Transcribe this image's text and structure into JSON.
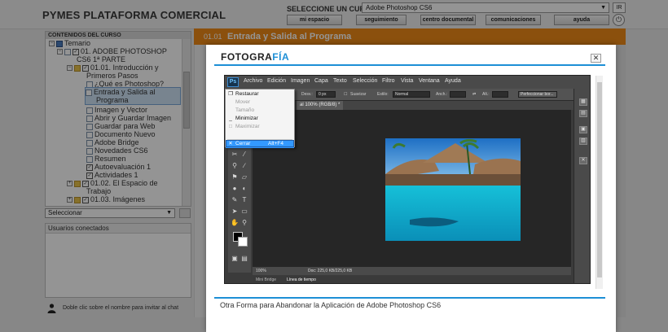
{
  "app": {
    "brand": "PYMES PLATAFORMA COMERCIAL",
    "course_label": "SELECCIONE UN CURSO:",
    "course_value": "Adobe Photoshop CS6",
    "ir_label": "IR",
    "nav": [
      "mi espacio",
      "seguimiento",
      "centro documental",
      "comunicaciones",
      "ayuda"
    ]
  },
  "left_panel": {
    "title": "CONTENIDOS DEL CURSO",
    "tree": [
      {
        "label": "Temario"
      },
      {
        "label": "01. ADOBE PHOTOSHOP"
      },
      {
        "label": "CS6 1ª PARTE"
      },
      {
        "label": "01.01. Introducción y"
      },
      {
        "label": "Primeros Pasos"
      },
      {
        "label": "¿Qué es Photoshop?"
      },
      {
        "label": "Entrada y Salida al"
      },
      {
        "label": "Programa"
      },
      {
        "label": "Imagen y Vector"
      },
      {
        "label": "Abrir y Guardar Imagen"
      },
      {
        "label": "Guardar para Web"
      },
      {
        "label": "Documento Nuevo"
      },
      {
        "label": "Adobe Bridge"
      },
      {
        "label": "Novedades CS6"
      },
      {
        "label": "Resumen"
      },
      {
        "label": "Autoevaluación 1"
      },
      {
        "label": "Actividades 1"
      },
      {
        "label": "01.02. El Espacio de"
      },
      {
        "label": "Trabajo"
      },
      {
        "label": "01.03. Imágenes"
      }
    ],
    "select_value": "Seleccionar",
    "users_title": "Usuarios conectados",
    "invite_text": "Doble clic sobre el nombre para invitar al chat"
  },
  "content": {
    "number": "01.01",
    "title": "Entrada y Salida al Programa"
  },
  "modal": {
    "logo_main": "FOTOGRA",
    "logo_accent": "FÍA",
    "close_label": "✕",
    "caption": "Otra Forma para Abandonar la Aplicación de Adobe Photoshop CS6"
  },
  "photoshop": {
    "logo": "Ps",
    "menu": [
      "Archivo",
      "Edición",
      "Imagen",
      "Capa",
      "Texto",
      "Selección",
      "Filtro",
      "Vista",
      "Ventana",
      "Ayuda"
    ],
    "options": {
      "desv_label": "Desv.:",
      "desv_value": "0 px",
      "suavizar": "Suavizar",
      "estilo_label": "Estilo:",
      "estilo_value": "Normal",
      "anch_label": "Anch.:",
      "alt_label": "Alt.:",
      "perfeccionar": "Perfeccionar bor..."
    },
    "doc_tab": "al 100% (RGB/8) *",
    "status_zoom": "100%",
    "status_doc": "Doc: 225,0 KB/225,0 KB",
    "bottom_tabs": [
      "Mini Bridge",
      "Línea de tiempo"
    ],
    "system_menu": [
      {
        "label": "Restaurar",
        "icon": "restore-icon",
        "glyph": "❐",
        "state": "enabled"
      },
      {
        "label": "Mover",
        "state": "disabled"
      },
      {
        "label": "Tamaño",
        "state": "disabled"
      },
      {
        "label": "Minimizar",
        "glyph": "_",
        "state": "enabled"
      },
      {
        "label": "Maximizar",
        "glyph": "□",
        "state": "disabled"
      },
      {
        "label": "Cerrar",
        "glyph": "✕",
        "accel": "Alt+F4",
        "state": "highlighted"
      }
    ]
  },
  "colors": {
    "accent_orange": "#f08a17",
    "accent_blue": "#1d8fd6",
    "menu_highlight": "#3399ff"
  }
}
